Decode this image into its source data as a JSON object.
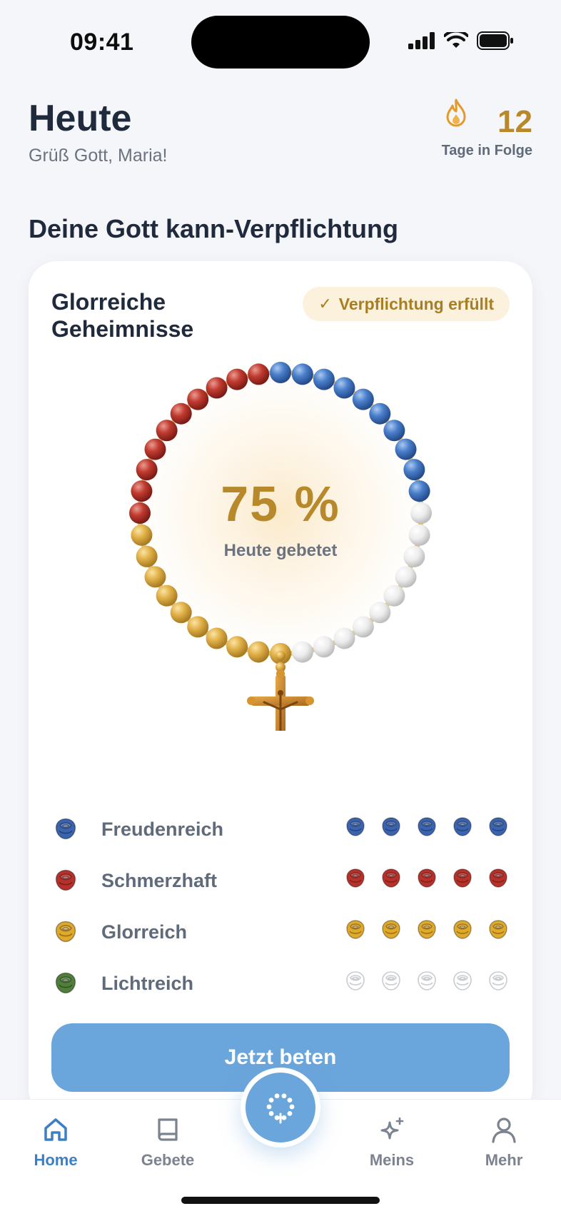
{
  "status_bar": {
    "time": "09:41"
  },
  "header": {
    "title": "Heute",
    "greeting": "Grüß Gott, Maria!",
    "streak_count": "12",
    "streak_label": "Tage in Folge",
    "streak_icon": "flame-icon"
  },
  "section_title": "Deine Gott kann-Verpflichtung",
  "card": {
    "title": "Glorreiche Geheimnisse",
    "badge": "Verpflichtung erfüllt",
    "progress_percent_text": "75 %",
    "progress_value": 0.75,
    "progress_label": "Heute gebetet",
    "mysteries": [
      {
        "label": "Freudenreich",
        "color": "#3a64b0",
        "completed": 5,
        "total": 5
      },
      {
        "label": "Schmerzhaft",
        "color": "#b8302a",
        "completed": 5,
        "total": 5
      },
      {
        "label": "Glorreich",
        "color": "#e0a92a",
        "completed": 5,
        "total": 5
      },
      {
        "label": "Lichtreich",
        "color": "#4f7f3a",
        "completed": 0,
        "total": 5
      }
    ],
    "cta_label": "Jetzt beten"
  },
  "tab_bar": {
    "tabs": [
      {
        "label": "Home",
        "icon": "home-icon",
        "active": true
      },
      {
        "label": "Gebete",
        "icon": "book-icon",
        "active": false
      },
      {
        "label": "Meins",
        "icon": "sparkle-icon",
        "active": false
      },
      {
        "label": "Mehr",
        "icon": "person-icon",
        "active": false
      }
    ],
    "center_icon": "rosary-icon"
  },
  "colors": {
    "accent_blue": "#6aa5db",
    "gold": "#b8892a",
    "bead_blue": "#3f74c0",
    "bead_red": "#b8302a",
    "bead_gold": "#d9a83a",
    "bead_white": "#ececec"
  }
}
